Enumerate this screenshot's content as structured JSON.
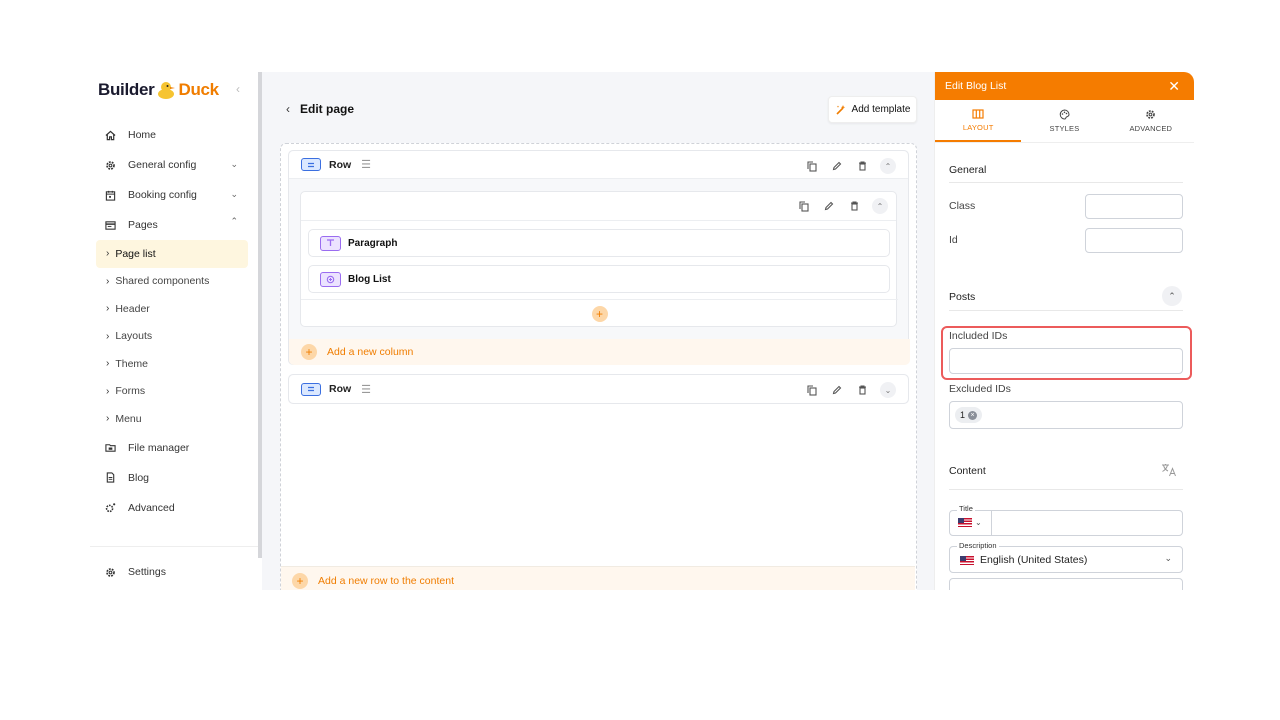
{
  "logo": {
    "part1": "Builder",
    "part2": "Duck"
  },
  "sidebar": {
    "items": [
      {
        "label": "Home",
        "icon": "home-icon"
      },
      {
        "label": "General config",
        "icon": "gear-icon"
      },
      {
        "label": "Booking config",
        "icon": "calendar-icon"
      },
      {
        "label": "Pages",
        "icon": "pages-icon"
      }
    ],
    "sub_items": [
      {
        "label": "Page list",
        "active": true
      },
      {
        "label": "Shared components"
      },
      {
        "label": "Header"
      },
      {
        "label": "Layouts"
      },
      {
        "label": "Theme"
      },
      {
        "label": "Forms"
      },
      {
        "label": "Menu"
      }
    ],
    "bottom_items": [
      {
        "label": "File manager",
        "icon": "folder-icon"
      },
      {
        "label": "Blog",
        "icon": "document-icon"
      },
      {
        "label": "Advanced",
        "icon": "advanced-gear-icon"
      }
    ],
    "settings": "Settings"
  },
  "main": {
    "title": "Edit page",
    "add_template": "Add template",
    "rows": [
      {
        "label": "Row"
      },
      {
        "label": "Row"
      }
    ],
    "widgets": [
      {
        "label": "Paragraph"
      },
      {
        "label": "Blog List"
      }
    ],
    "add_column": "Add a new column",
    "add_row": "Add a new row to the content"
  },
  "panel": {
    "title": "Edit Blog List",
    "tabs": [
      "LAYOUT",
      "STYLES",
      "ADVANCED"
    ],
    "general_title": "General",
    "class_label": "Class",
    "id_label": "Id",
    "posts_title": "Posts",
    "included_label": "Included IDs",
    "included_value": "",
    "excluded_label": "Excluded IDs",
    "excluded_chip": "1",
    "content_title": "Content",
    "title_field_label": "Title",
    "description_field_label": "Description",
    "description_value": "English (United States)"
  },
  "colors": {
    "accent": "#f57c00",
    "highlight": "#ec5b5b",
    "row_badge": "#3b6fe0",
    "widget_badge": "#9a6cf0"
  }
}
